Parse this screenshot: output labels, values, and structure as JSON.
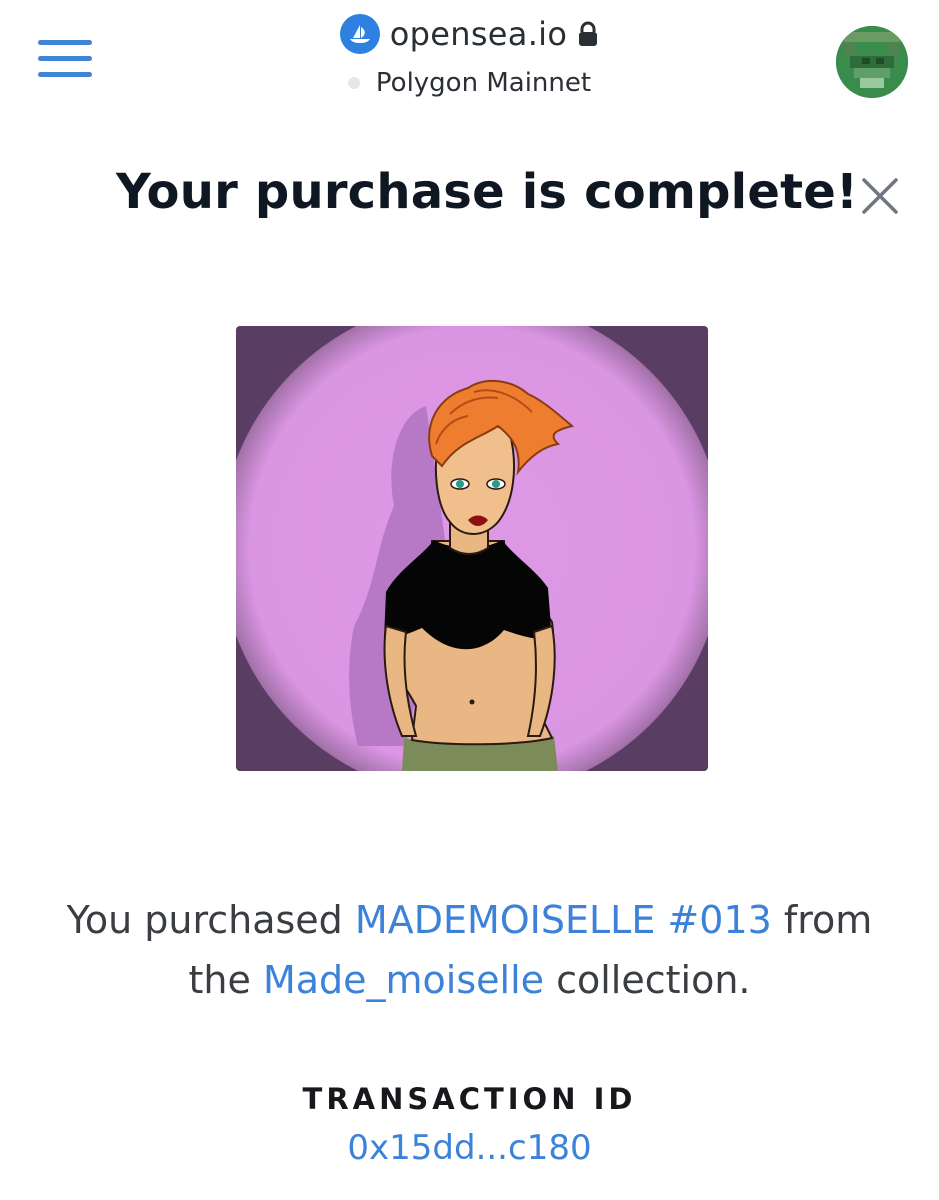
{
  "header": {
    "site": "opensea.io",
    "network": "Polygon Mainnet",
    "icons": [
      "menu-icon",
      "opensea-logo",
      "lock-icon",
      "user-avatar"
    ],
    "brand_color": "#2f81e1"
  },
  "modal": {
    "title": "Your purchase is complete!",
    "close_icon": "close-icon",
    "nft_image": "cartoon-illustration-red-haired-woman",
    "message": {
      "pre": "You purchased",
      "item_name": "MADEMOISELLE #013",
      "mid_from": "from",
      "mid_the": "the",
      "collection_name": "Made_moiselle",
      "post": "collection."
    },
    "transaction": {
      "label": "TRANSACTION ID",
      "id": "0x15dd...c180"
    },
    "link_color": "#3c82d9"
  }
}
